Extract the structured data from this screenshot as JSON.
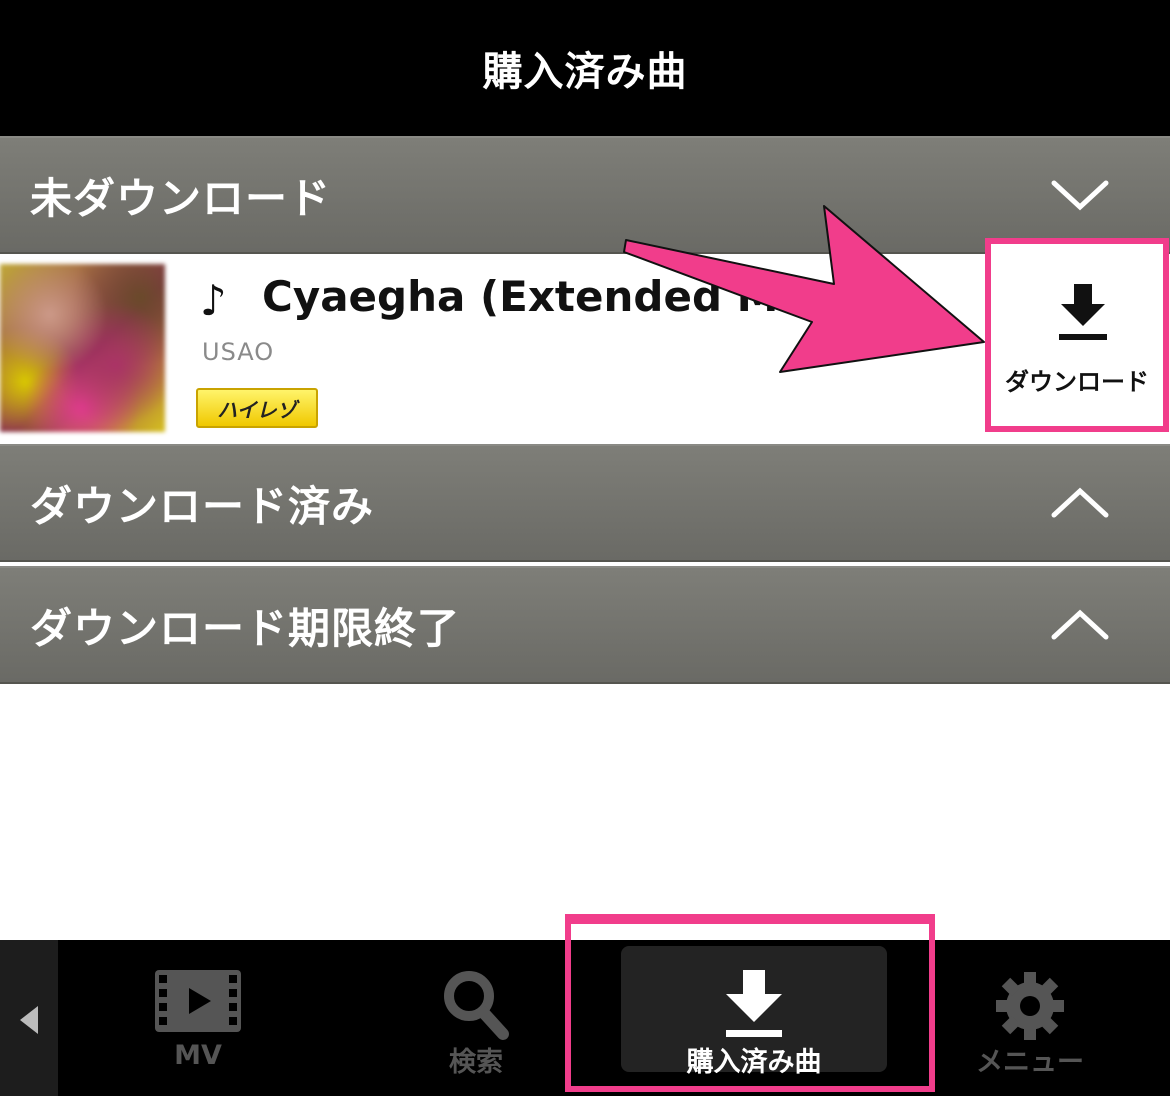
{
  "header": {
    "title": "購入済み曲"
  },
  "sections": [
    {
      "label": "未ダウンロード",
      "chevron": "chevron-down-icon"
    },
    {
      "label": "ダウンロード済み",
      "chevron": "chevron-up-icon"
    },
    {
      "label": "ダウンロード期限終了",
      "chevron": "chevron-up-icon"
    }
  ],
  "track": {
    "note": "♪",
    "title": "Cyaegha (Extended Mix)",
    "artist": "USAO",
    "badge": "ハイレゾ",
    "download_label": "ダウンロード"
  },
  "tabbar": {
    "items": [
      {
        "label": "MV",
        "icon": "film-icon"
      },
      {
        "label": "検索",
        "icon": "search-icon"
      },
      {
        "label": "購入済み曲",
        "icon": "download-icon",
        "active": true
      },
      {
        "label": "メニュー",
        "icon": "gear-icon"
      }
    ]
  },
  "colors": {
    "highlight": "#f13d8b",
    "section_bg": "#757570",
    "badge": "#f7d800"
  }
}
